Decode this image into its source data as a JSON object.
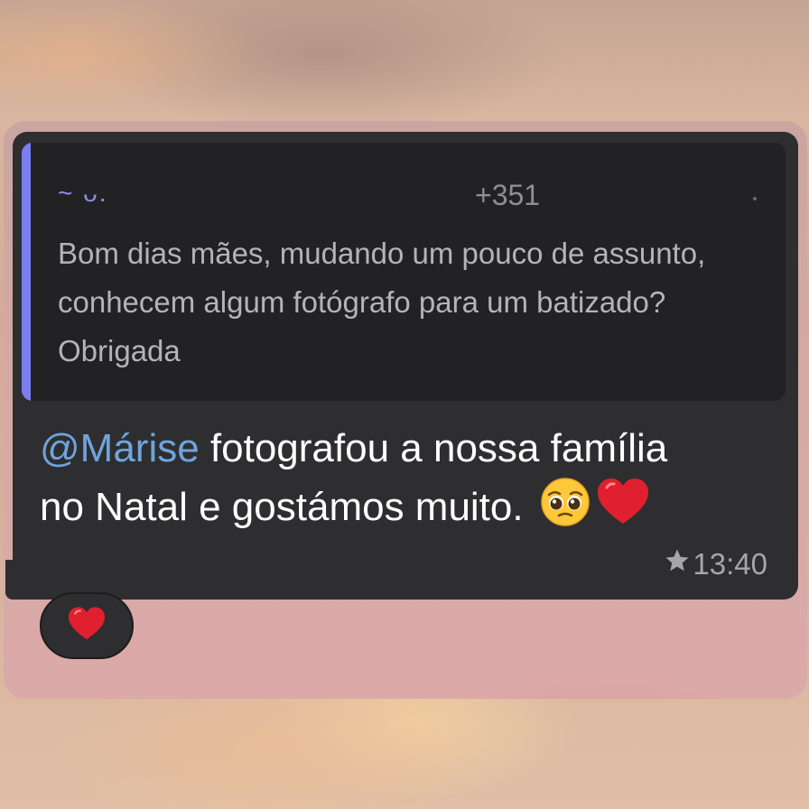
{
  "quoted_message": {
    "author": "~ ᴗ.",
    "phone": "+351",
    "text": "Bom dias mães, mudando um pouco de assunto, conhecem algum fotógrafo para um batizado? Obrigada"
  },
  "message": {
    "mention": "@Márise",
    "text_line1": " fotografou a nossa família",
    "text_line2": "no Natal e gostámos muito.",
    "emojis": [
      "pleading-face-emoji",
      "red-heart-emoji"
    ],
    "starred": true,
    "time": "13:40"
  },
  "reaction": {
    "emoji": "red-heart-emoji"
  },
  "colors": {
    "bubble": "#2e2e30",
    "quote_background": "#222224",
    "quote_bar": "#7b7ef0",
    "mention": "#6fa4dc",
    "heart": "#e0202e"
  }
}
